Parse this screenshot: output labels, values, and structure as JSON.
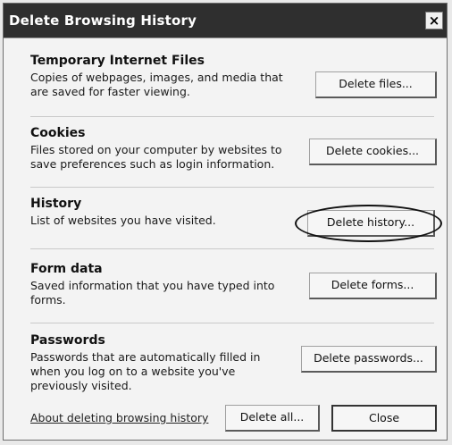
{
  "window": {
    "title": "Delete Browsing History",
    "close_glyph": "×"
  },
  "sections": [
    {
      "heading": "Temporary Internet Files",
      "description": "Copies of webpages, images, and media that are saved for faster viewing.",
      "button_label": "Delete files..."
    },
    {
      "heading": "Cookies",
      "description": "Files stored on your computer by websites to save preferences such as login information.",
      "button_label": "Delete cookies..."
    },
    {
      "heading": "History",
      "description": "List of websites you have visited.",
      "button_label": "Delete history..."
    },
    {
      "heading": "Form data",
      "description": "Saved information that you have typed into forms.",
      "button_label": "Delete forms..."
    },
    {
      "heading": "Passwords",
      "description": "Passwords that are automatically filled in when you log on to a website you've previously visited.",
      "button_label": "Delete passwords..."
    }
  ],
  "footer": {
    "link_label": "About deleting browsing history",
    "delete_all_label": "Delete all...",
    "close_label": "Close"
  }
}
